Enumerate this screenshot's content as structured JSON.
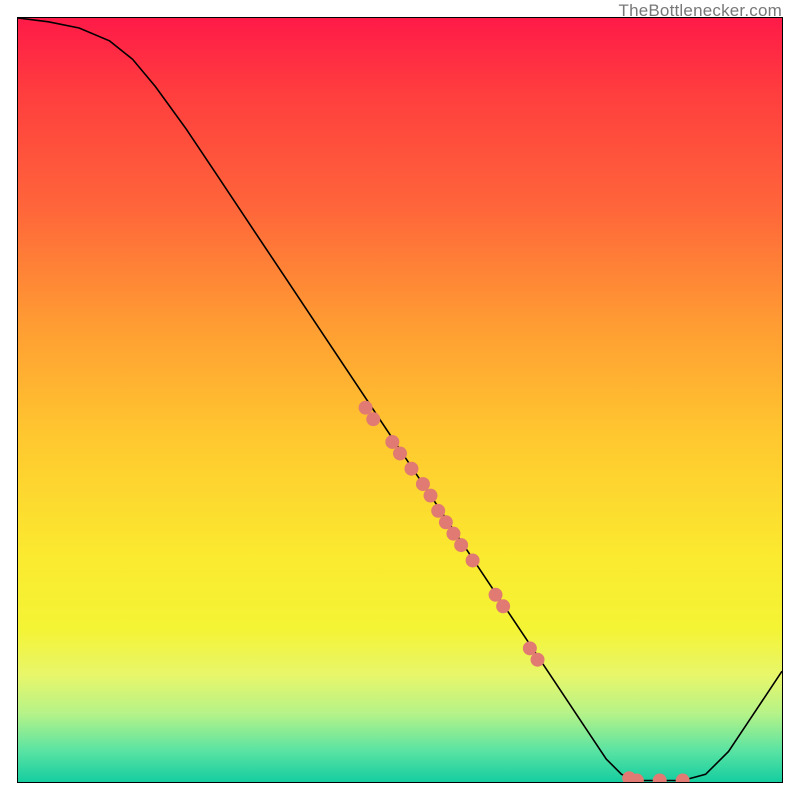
{
  "watermark": {
    "text": "TheBottlenecker.com"
  },
  "chart_data": {
    "type": "line",
    "title": "",
    "xlabel": "",
    "ylabel": "",
    "xlim": [
      0,
      100
    ],
    "ylim": [
      0,
      100
    ],
    "grid": false,
    "legend_position": "none",
    "curve": [
      {
        "x": 0,
        "y": 100
      },
      {
        "x": 4,
        "y": 99.5
      },
      {
        "x": 8,
        "y": 98.7
      },
      {
        "x": 12,
        "y": 97.0
      },
      {
        "x": 15,
        "y": 94.6
      },
      {
        "x": 18,
        "y": 91.0
      },
      {
        "x": 22,
        "y": 85.5
      },
      {
        "x": 26,
        "y": 79.5
      },
      {
        "x": 30,
        "y": 73.5
      },
      {
        "x": 35,
        "y": 66.0
      },
      {
        "x": 40,
        "y": 58.5
      },
      {
        "x": 45,
        "y": 51.0
      },
      {
        "x": 50,
        "y": 43.5
      },
      {
        "x": 55,
        "y": 36.0
      },
      {
        "x": 60,
        "y": 28.5
      },
      {
        "x": 65,
        "y": 21.0
      },
      {
        "x": 70,
        "y": 13.5
      },
      {
        "x": 74,
        "y": 7.5
      },
      {
        "x": 77,
        "y": 3.0
      },
      {
        "x": 79,
        "y": 1.0
      },
      {
        "x": 81,
        "y": 0.2
      },
      {
        "x": 84,
        "y": 0.2
      },
      {
        "x": 87,
        "y": 0.2
      },
      {
        "x": 90,
        "y": 1.0
      },
      {
        "x": 93,
        "y": 4.0
      },
      {
        "x": 96,
        "y": 8.5
      },
      {
        "x": 100,
        "y": 14.5
      }
    ],
    "scatter": [
      {
        "x": 45.5,
        "y": 49.0
      },
      {
        "x": 46.5,
        "y": 47.5
      },
      {
        "x": 49.0,
        "y": 44.5
      },
      {
        "x": 50.0,
        "y": 43.0
      },
      {
        "x": 51.5,
        "y": 41.0
      },
      {
        "x": 53.0,
        "y": 39.0
      },
      {
        "x": 54.0,
        "y": 37.5
      },
      {
        "x": 55.0,
        "y": 35.5
      },
      {
        "x": 56.0,
        "y": 34.0
      },
      {
        "x": 57.0,
        "y": 32.5
      },
      {
        "x": 58.0,
        "y": 31.0
      },
      {
        "x": 59.5,
        "y": 29.0
      },
      {
        "x": 62.5,
        "y": 24.5
      },
      {
        "x": 63.5,
        "y": 23.0
      },
      {
        "x": 67.0,
        "y": 17.5
      },
      {
        "x": 68.0,
        "y": 16.0
      },
      {
        "x": 80.0,
        "y": 0.5
      },
      {
        "x": 81.0,
        "y": 0.2
      },
      {
        "x": 84.0,
        "y": 0.2
      },
      {
        "x": 87.0,
        "y": 0.2
      }
    ],
    "annotations": []
  }
}
